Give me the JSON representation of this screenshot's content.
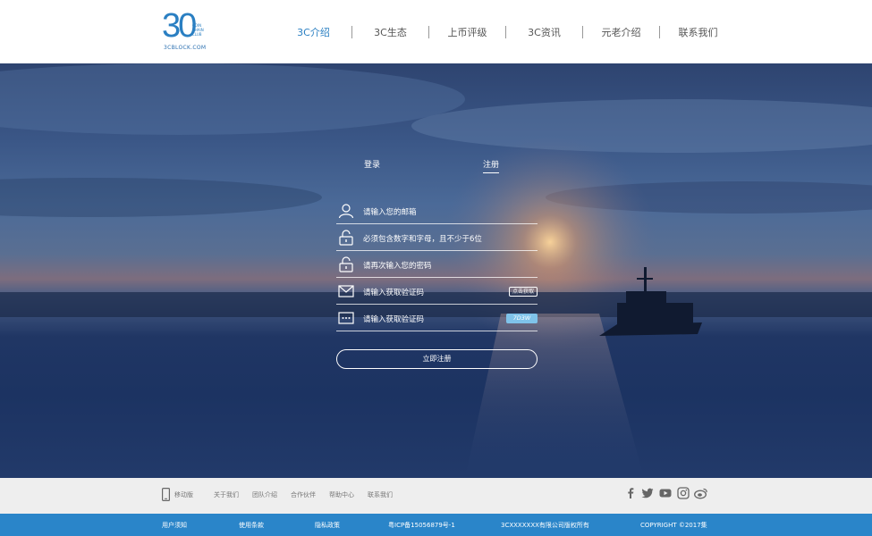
{
  "logo": {
    "text": "30",
    "sub": "3CBLOCK.COM",
    "tag": "COIN CHAIN CLUB"
  },
  "nav": {
    "items": [
      {
        "label": "3C介绍",
        "active": true
      },
      {
        "label": "3C生态"
      },
      {
        "label": "上币评级"
      },
      {
        "label": "3C资讯"
      },
      {
        "label": "元老介绍"
      },
      {
        "label": "联系我们"
      }
    ]
  },
  "form": {
    "tab_login": "登录",
    "tab_register": "注册",
    "fields": [
      {
        "placeholder": "请输入您的邮箱",
        "icon": "user-icon"
      },
      {
        "placeholder": "必须包含数字和字母，且不少于6位",
        "icon": "lock-icon"
      },
      {
        "placeholder": "请再次输入您的密码",
        "icon": "lock-icon"
      },
      {
        "placeholder": "请输入获取验证码",
        "icon": "mail-icon",
        "action": "点击获取"
      },
      {
        "placeholder": "请输入获取验证码",
        "icon": "captcha-icon",
        "captcha": "7D3W"
      }
    ],
    "submit": "立即注册"
  },
  "footer_links": {
    "mobile": "移动版",
    "about": "关于我们",
    "team": "团队介绍",
    "partners": "合作伙伴",
    "help": "帮助中心",
    "contact": "联系我们"
  },
  "social_icons": [
    "facebook-icon",
    "twitter-icon",
    "youtube-icon",
    "instagram-icon",
    "weibo-icon"
  ],
  "bottom_bar": {
    "user_notice": "用户须知",
    "terms": "使用条款",
    "privacy": "隐私政策",
    "icp": "粤ICP备15056879号-1",
    "copyright_company": "3CXXXXXXX有限公司版权所有",
    "copyright": "COPYRIGHT ©2017集"
  },
  "colors": {
    "accent": "#2a7fc2",
    "bottom_bar": "#2a85c9",
    "footer_bg": "#eeeeee",
    "captcha": "#7fc3ea"
  }
}
